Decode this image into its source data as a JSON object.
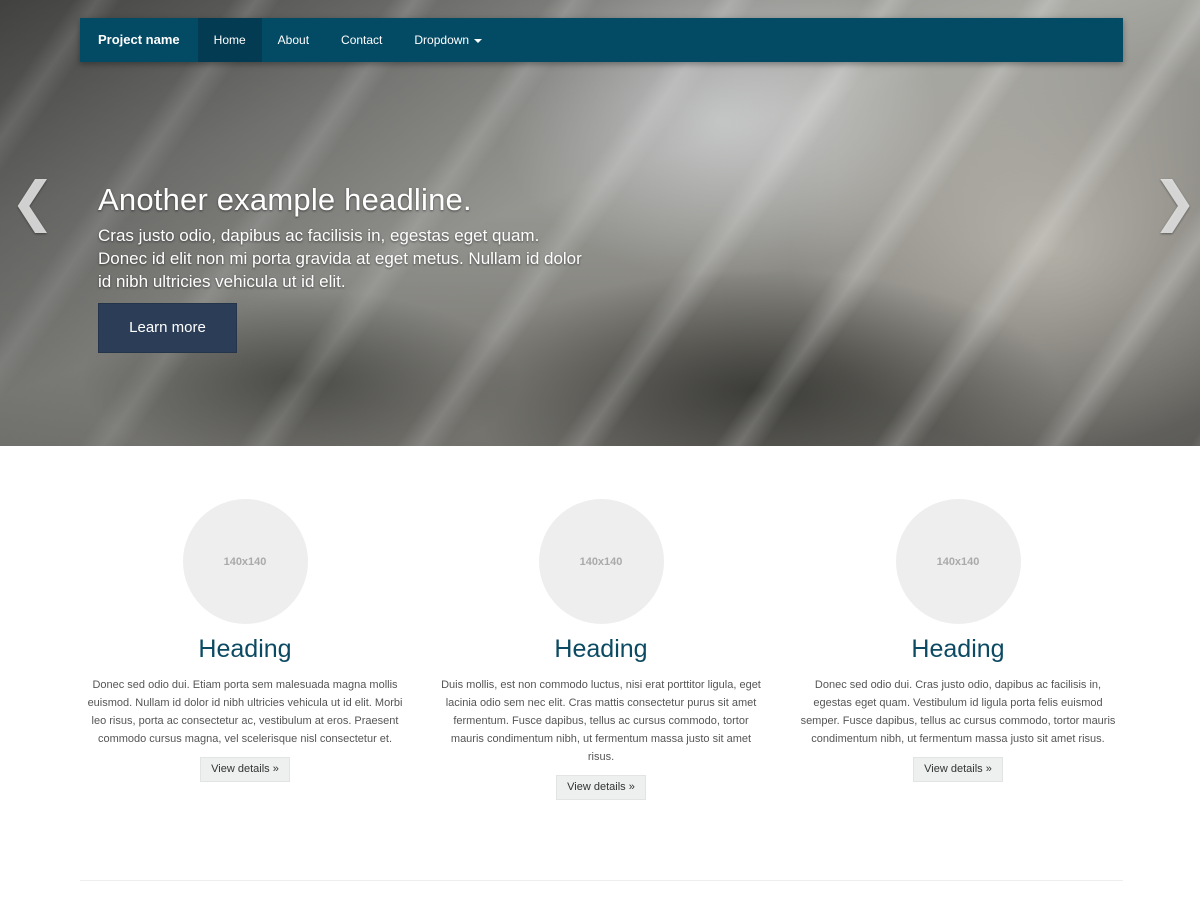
{
  "navbar": {
    "brand": "Project name",
    "items": [
      {
        "label": "Home",
        "active": true
      },
      {
        "label": "About",
        "active": false
      },
      {
        "label": "Contact",
        "active": false
      },
      {
        "label": "Dropdown",
        "active": false,
        "has_caret": true
      }
    ],
    "color": "#034a64"
  },
  "carousel": {
    "prev_arrow": "❮",
    "next_arrow": "❯",
    "headline": "Another example headline.",
    "text": "Cras justo odio, dapibus ac facilisis in, egestas eget quam. Donec id elit non mi porta gravida at eget metus. Nullam id dolor id nibh ultricies vehicula ut id elit.",
    "button_label": "Learn more",
    "button_color": "#2b3d57"
  },
  "features": [
    {
      "thumb_label": "140x140",
      "heading": "Heading",
      "text": "Donec sed odio dui. Etiam porta sem malesuada magna mollis euismod. Nullam id dolor id nibh ultricies vehicula ut id elit. Morbi leo risus, porta ac consectetur ac, vestibulum at eros. Praesent commodo cursus magna, vel scelerisque nisl consectetur et.",
      "button_label": "View details »"
    },
    {
      "thumb_label": "140x140",
      "heading": "Heading",
      "text": "Duis mollis, est non commodo luctus, nisi erat porttitor ligula, eget lacinia odio sem nec elit. Cras mattis consectetur purus sit amet fermentum. Fusce dapibus, tellus ac cursus commodo, tortor mauris condimentum nibh, ut fermentum massa justo sit amet risus.",
      "button_label": "View details »"
    },
    {
      "thumb_label": "140x140",
      "heading": "Heading",
      "text": "Donec sed odio dui. Cras justo odio, dapibus ac facilisis in, egestas eget quam. Vestibulum id ligula porta felis euismod semper. Fusce dapibus, tellus ac cursus commodo, tortor mauris condimentum nibh, ut fermentum massa justo sit amet risus.",
      "button_label": "View details »"
    }
  ],
  "colors": {
    "heading": "#0b4a62",
    "thumb": "#eeeeee"
  }
}
